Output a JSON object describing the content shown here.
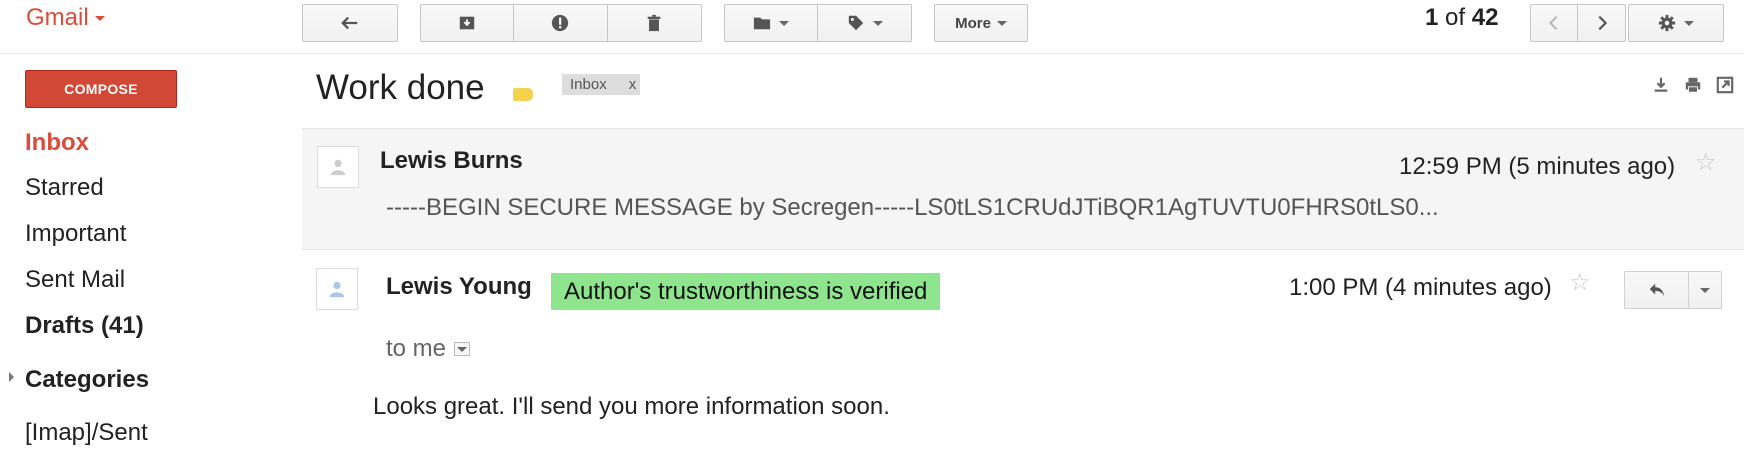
{
  "app": {
    "name": "Gmail"
  },
  "toolbar": {
    "more_label": "More",
    "pager": {
      "current": "1",
      "of_label": "of",
      "total": "42"
    }
  },
  "sidebar": {
    "compose_label": "COMPOSE",
    "items": [
      {
        "label": "Inbox"
      },
      {
        "label": "Starred"
      },
      {
        "label": "Important"
      },
      {
        "label": "Sent Mail"
      },
      {
        "label": "Drafts (41)"
      },
      {
        "label": "Categories"
      },
      {
        "label": "[Imap]/Sent"
      }
    ]
  },
  "thread": {
    "subject": "Work done",
    "label_chip": {
      "label": "Inbox",
      "close": "x"
    },
    "messages": [
      {
        "sender": "Lewis Burns",
        "time": "12:59 PM (5 minutes ago)",
        "snippet": "-----BEGIN SECURE MESSAGE by Secregen-----LS0tLS1CRUdJTiBQR1AgTUVTU0FHRS0tLS0..."
      },
      {
        "sender": "Lewis Young",
        "verified_badge": "Author's trustworthiness is verified",
        "time": "1:00 PM (4 minutes ago)",
        "to_label": "to me",
        "body": "Looks great. I'll send you more information soon."
      }
    ]
  },
  "colors": {
    "brand_red": "#dd4b39",
    "compose_bg": "#d14836",
    "verified_bg": "#8ee58e",
    "label_yellow": "#f4d24e"
  }
}
